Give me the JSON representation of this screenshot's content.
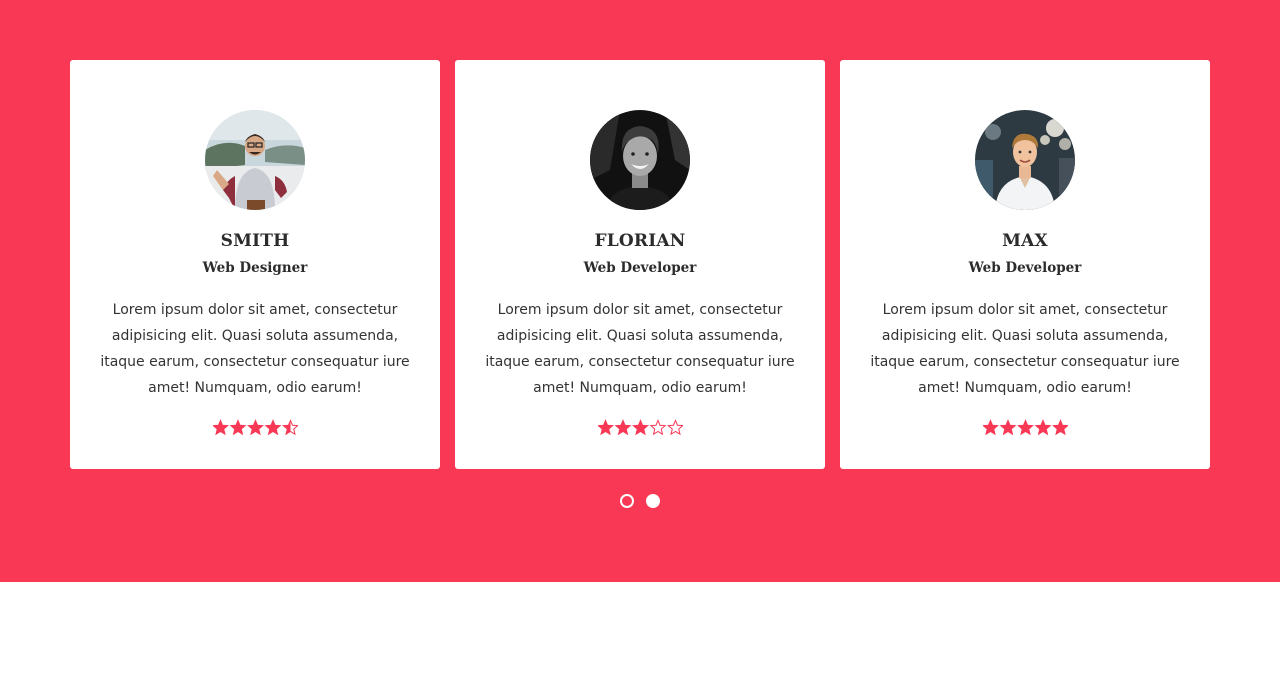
{
  "theme": {
    "accent": "#f83854",
    "card_bg": "#ffffff",
    "text": "#2b2b2b"
  },
  "cards": [
    {
      "name": "SMITH",
      "role": "Web Designer",
      "description": "Lorem ipsum dolor sit amet, consectetur adipisicing elit. Quasi soluta assumenda, itaque earum, consectetur consequatur iure amet! Numquam, odio earum!",
      "avatar_icon": "photo-man-glasses-raglan-tee",
      "rating": 4.5,
      "rating_max": 5
    },
    {
      "name": "FLORIAN",
      "role": "Web Developer",
      "description": "Lorem ipsum dolor sit amet, consectetur adipisicing elit. Quasi soluta assumenda, itaque earum, consectetur consequatur iure amet! Numquam, odio earum!",
      "avatar_icon": "photo-man-black-and-white",
      "rating": 3,
      "rating_max": 5
    },
    {
      "name": "MAX",
      "role": "Web Developer",
      "description": "Lorem ipsum dolor sit amet, consectetur adipisicing elit. Quasi soluta assumenda, itaque earum, consectetur consequatur iure amet! Numquam, odio earum!",
      "avatar_icon": "photo-young-man-white-shirt",
      "rating": 5,
      "rating_max": 5
    }
  ],
  "pagination": {
    "pages": 2,
    "active_page": 2
  }
}
